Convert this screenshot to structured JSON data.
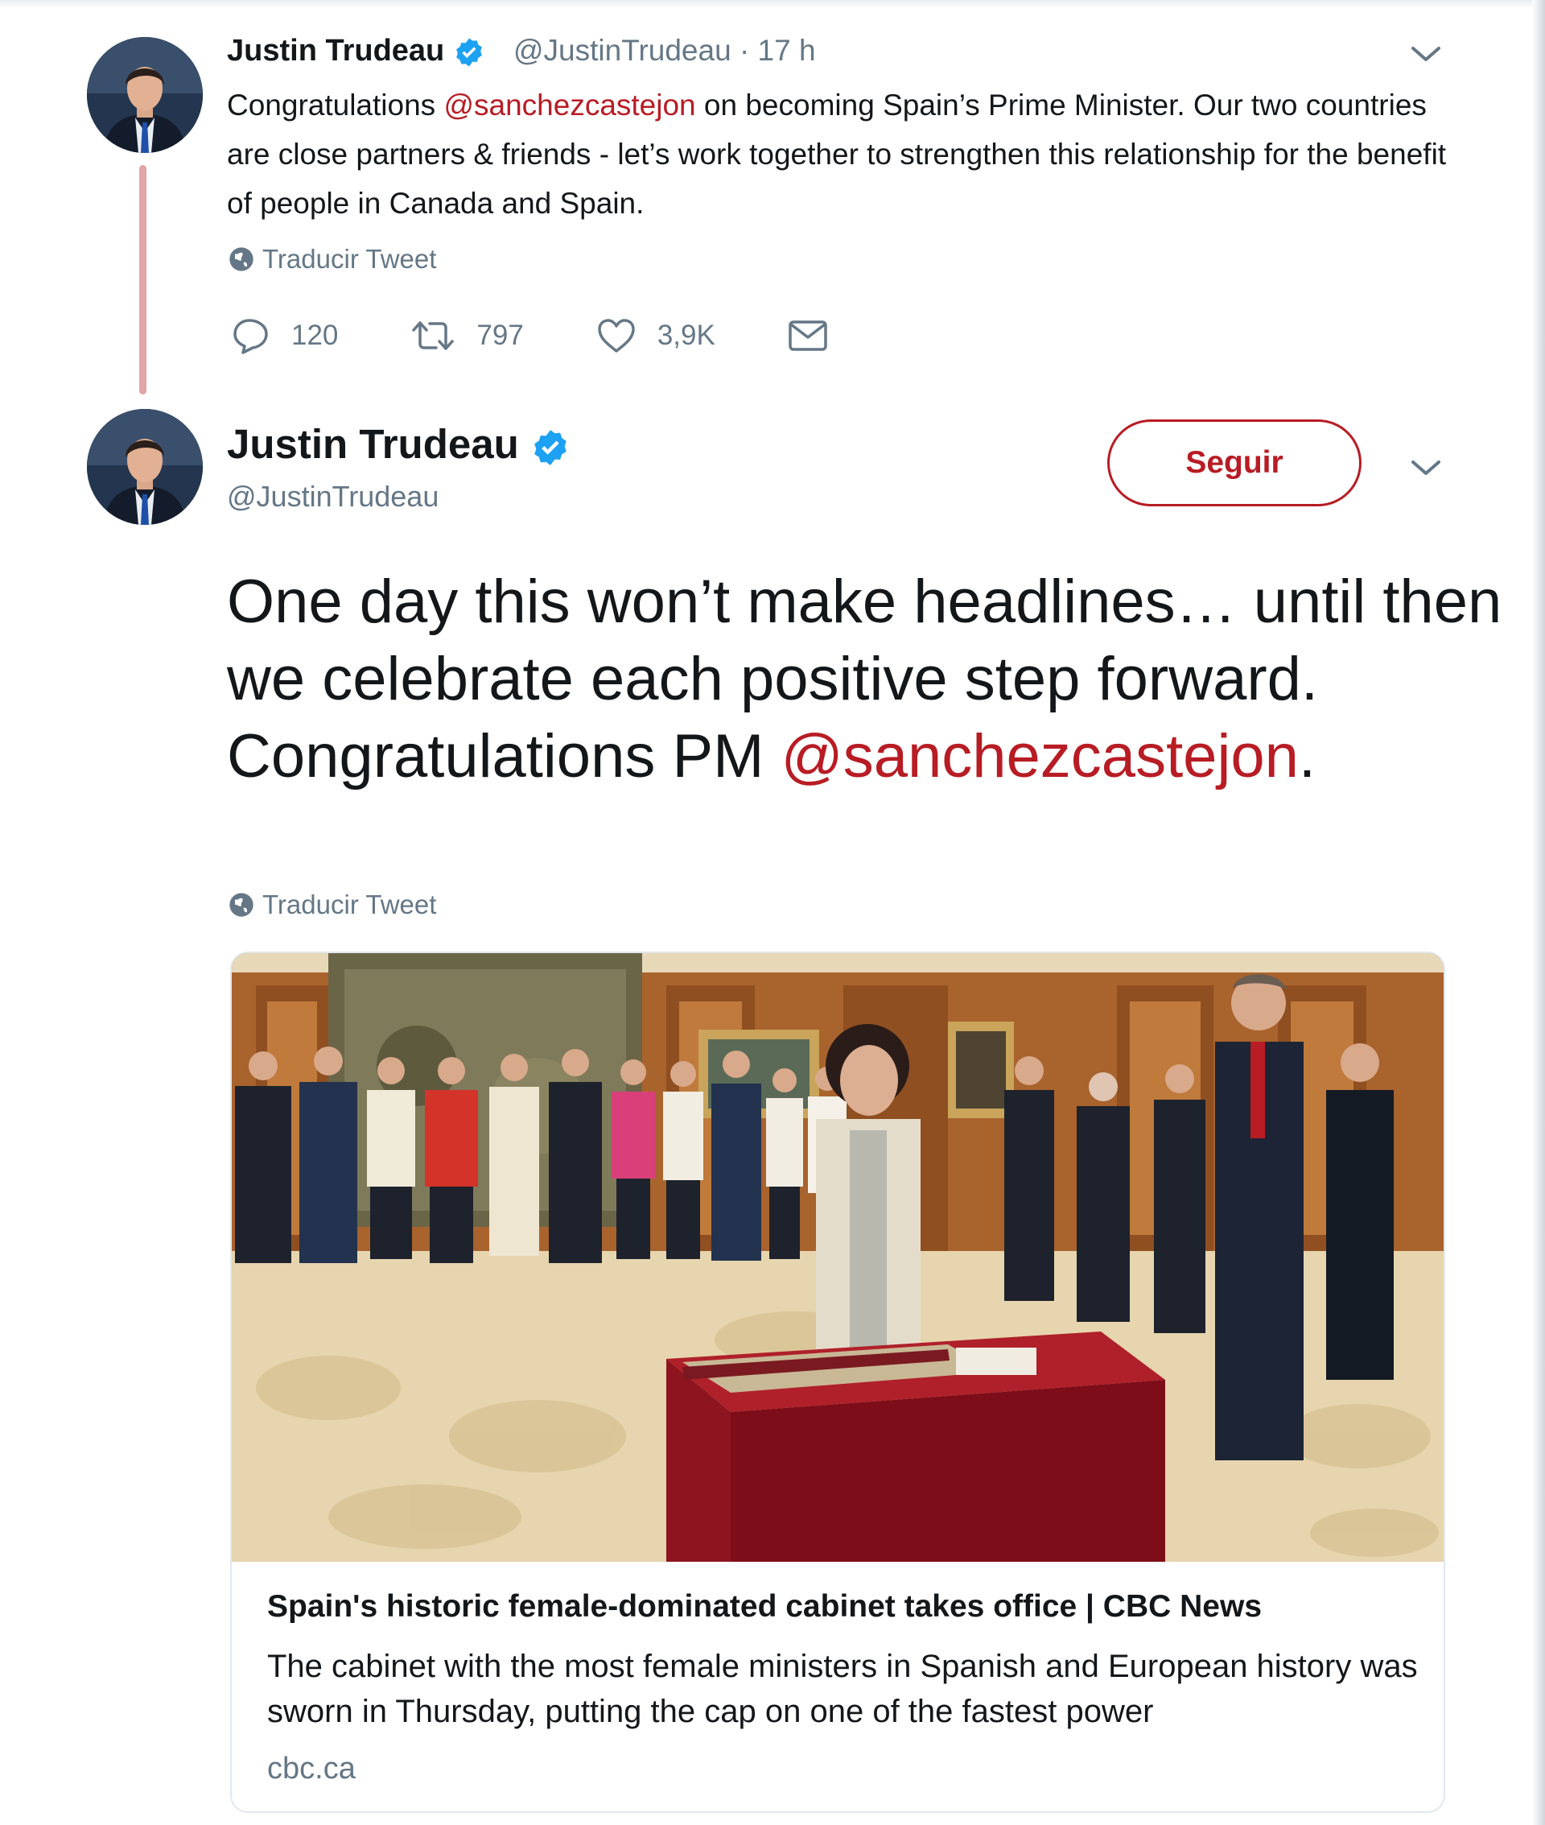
{
  "tweet1": {
    "name": "Justin Trudeau",
    "handle": "@JustinTrudeau",
    "separator": "·",
    "time": "17 h",
    "text_before": "Congratulations ",
    "mention": "@sanchezcastejon",
    "text_after": " on becoming Spain’s Prime Minister. Our two countries are close partners & friends - let’s work together to strengthen this relationship for the benefit of people in Canada and Spain.",
    "translate_label": "Traducir Tweet",
    "replies": "120",
    "retweets": "797",
    "likes": "3,9K"
  },
  "tweet2": {
    "name": "Justin Trudeau",
    "handle": "@JustinTrudeau",
    "follow_label": "Seguir",
    "text": "One day this won’t make headlines… until then we celebrate each positive step forward. Congratulations PM ",
    "mention": "@sanchezcastejon",
    "text_end": ".",
    "translate_label": "Traducir Tweet",
    "card": {
      "title": "Spain's historic female-dominated cabinet takes office | CBC News",
      "description": "The cabinet with the most female ministers in Spanish and European history was sworn in Thursday, putting the cap on one of the fastest power",
      "domain": "cbc.ca"
    }
  },
  "colors": {
    "accent": "#b81c24",
    "verified": "#1da1f2",
    "muted": "#657786",
    "thread_line": "#e1a4a7"
  },
  "icons": [
    "verified-badge-icon",
    "chevron-down-icon",
    "globe-icon",
    "reply-icon",
    "retweet-icon",
    "like-icon",
    "message-icon"
  ]
}
